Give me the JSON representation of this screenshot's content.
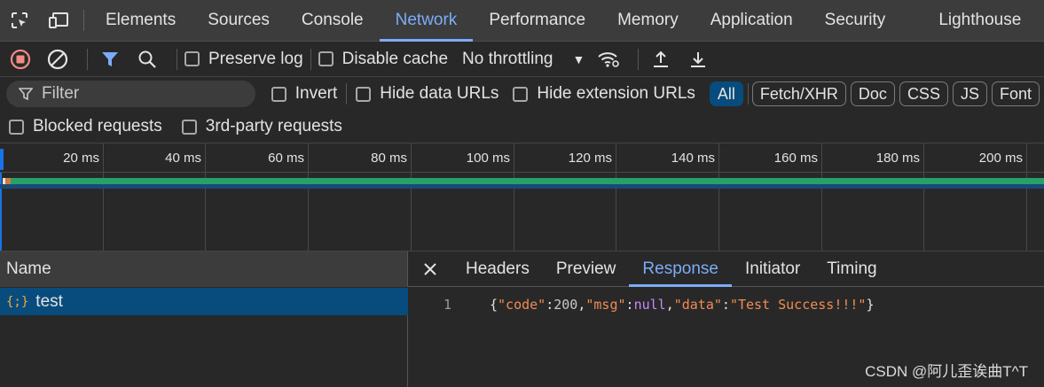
{
  "tabs": {
    "elements": "Elements",
    "sources": "Sources",
    "console": "Console",
    "network": "Network",
    "performance": "Performance",
    "memory": "Memory",
    "application": "Application",
    "security": "Security",
    "lighthouse": "Lighthouse"
  },
  "toolbar": {
    "preserve_log": "Preserve log",
    "disable_cache": "Disable cache",
    "throttling": "No throttling"
  },
  "filter": {
    "placeholder": "Filter",
    "invert": "Invert",
    "hide_data_urls": "Hide data URLs",
    "hide_extension_urls": "Hide extension URLs",
    "types": [
      "All",
      "Fetch/XHR",
      "Doc",
      "CSS",
      "JS",
      "Font"
    ],
    "active_type": "All"
  },
  "row2": {
    "blocked_requests": "Blocked requests",
    "third_party": "3rd-party requests"
  },
  "timeline": {
    "ticks": [
      "20 ms",
      "40 ms",
      "60 ms",
      "80 ms",
      "100 ms",
      "120 ms",
      "140 ms",
      "160 ms",
      "180 ms",
      "200 ms"
    ]
  },
  "requests": {
    "header": "Name",
    "selected": {
      "icon": "{;}",
      "name": "test"
    }
  },
  "detail": {
    "tabs": [
      "Headers",
      "Preview",
      "Response",
      "Initiator",
      "Timing"
    ],
    "active_tab": "Response",
    "line_number": "1",
    "response": {
      "open": "{",
      "k1": "\"code\"",
      "v1": "200",
      "k2": "\"msg\"",
      "v2": "null",
      "k3": "\"data\"",
      "v3": "\"Test Success!!!\"",
      "close": "}"
    }
  },
  "watermark": "CSDN @阿儿歪诶曲T^T",
  "colors": {
    "accent": "#7cacf8",
    "selected_row": "#074c7c",
    "record_red": "#f28b82",
    "string": "#f28b54",
    "keyword": "#c58af9"
  }
}
